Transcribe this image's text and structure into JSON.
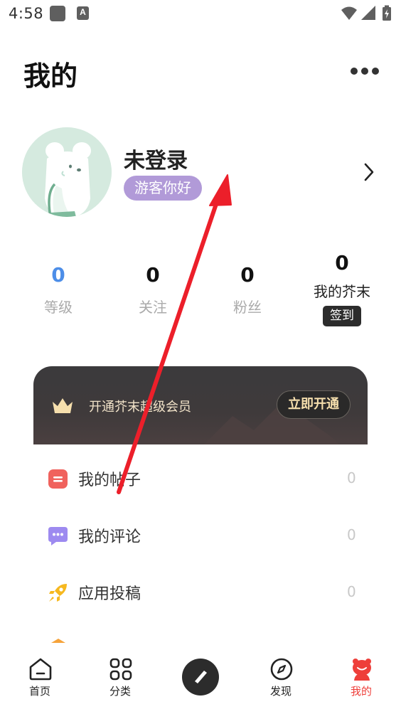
{
  "status_bar": {
    "time": "4:58",
    "ime_badge": "A",
    "icons": [
      "app-square-icon",
      "keyboard-a-icon",
      "wifi-icon",
      "signal-icon",
      "battery-charging-icon"
    ]
  },
  "header": {
    "title": "我的",
    "more_icon": "more-dots-icon"
  },
  "profile": {
    "name": "未登录",
    "badge": "游客你好",
    "avatar_icon": "bear-avatar-icon",
    "chevron_icon": "chevron-right-icon"
  },
  "stats": [
    {
      "value": "0",
      "label": "等级",
      "accent": "#4d8ee8"
    },
    {
      "value": "0",
      "label": "关注"
    },
    {
      "value": "0",
      "label": "粉丝"
    }
  ],
  "mustard": {
    "value": "0",
    "label": "我的芥末",
    "button": "签到"
  },
  "vip": {
    "text": "开通芥末超级会员",
    "button": "立即开通",
    "icon": "crown-icon"
  },
  "menu": [
    {
      "label": "我的帖子",
      "count": "0",
      "icon": "post-icon",
      "color": "#f0625d"
    },
    {
      "label": "我的评论",
      "count": "0",
      "icon": "comment-icon",
      "color": "#9d8af0"
    },
    {
      "label": "应用投稿",
      "count": "0",
      "icon": "rocket-icon",
      "color": "#f6b81f"
    }
  ],
  "tabs": [
    {
      "label": "首页",
      "icon": "home-icon"
    },
    {
      "label": "分类",
      "icon": "category-grid-icon"
    },
    {
      "label": "",
      "icon": "compose-pen-icon"
    },
    {
      "label": "发现",
      "icon": "compass-icon"
    },
    {
      "label": "我的",
      "icon": "mine-mascot-icon",
      "active": true
    }
  ],
  "colors": {
    "accent_red": "#ee3f3a",
    "badge_purple": "#b19ad8",
    "vip_gold": "#f6dfad",
    "level_blue": "#4d8ee8"
  }
}
